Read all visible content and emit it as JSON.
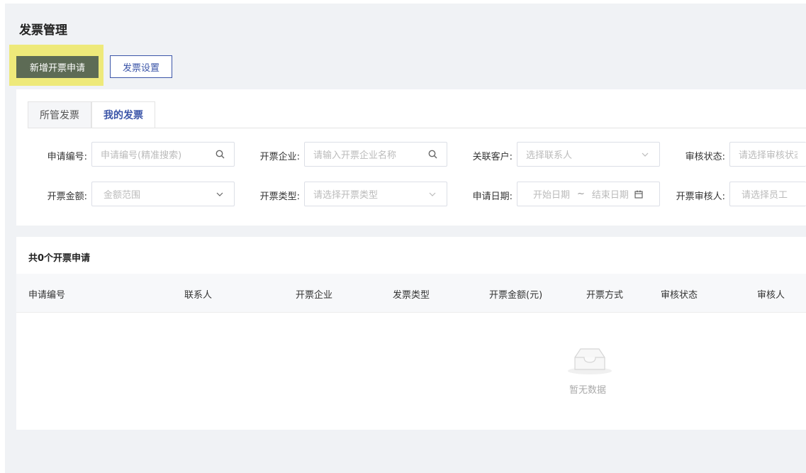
{
  "page": {
    "title": "发票管理",
    "new_button": "新增开票申请",
    "settings_button": "发票设置"
  },
  "tabs": [
    {
      "label": "所管发票",
      "active": false
    },
    {
      "label": "我的发票",
      "active": true
    }
  ],
  "filters": {
    "apply_no": {
      "label": "申请编号:",
      "placeholder": "申请编号(精准搜索)",
      "icon": "search-icon"
    },
    "company": {
      "label": "开票企业:",
      "placeholder": "请输入开票企业名称",
      "icon": "search-icon"
    },
    "customer": {
      "label": "关联客户:",
      "placeholder": "选择联系人",
      "icon": "chevron-down-icon"
    },
    "review_status": {
      "label": "审核状态:",
      "placeholder": "请选择审核状态"
    },
    "amount": {
      "label": "开票金额:",
      "placeholder": "金额范围",
      "icon": "chevron-down-icon"
    },
    "type": {
      "label": "开票类型:",
      "placeholder": "请选择开票类型",
      "icon": "chevron-down-icon"
    },
    "date": {
      "label": "申请日期:",
      "start_placeholder": "开始日期",
      "separator": "~",
      "end_placeholder": "结束日期",
      "icon": "calendar-icon"
    },
    "reviewer": {
      "label": "开票审核人:",
      "placeholder": "请选择员工"
    }
  },
  "table": {
    "total_text": "共0个开票申请",
    "columns": [
      "申请编号",
      "联系人",
      "开票企业",
      "发票类型",
      "开票金额(元)",
      "开票方式",
      "审核状态",
      "审核人"
    ],
    "rows": [],
    "empty_text": "暂无数据"
  },
  "colors": {
    "primary": "#3b55a8",
    "highlight": "#eee97a",
    "button_bg": "#5d6b55"
  }
}
